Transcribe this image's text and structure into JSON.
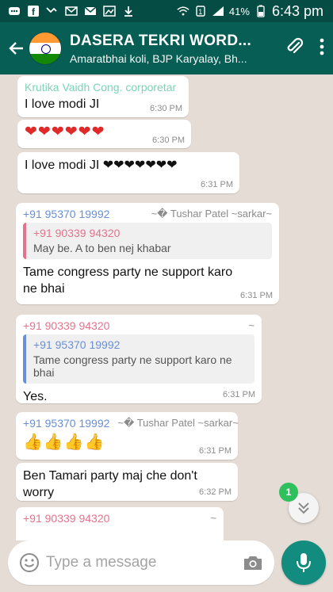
{
  "status_bar": {
    "battery_percent": "41%",
    "time": "6:43 pm"
  },
  "header": {
    "title": "DASERA TEKRI WORD...",
    "subtitle": "Amaratbhai koli, BJP Karyalay, Bh..."
  },
  "colors": {
    "header_bg": "#075e54",
    "status_bg": "#054d44",
    "chat_bg": "#e5ddd5",
    "sender_teal": "#7dd3b6",
    "sender_blue": "#6a8fd6",
    "sender_pink": "#e2738d",
    "fab_green": "#128c7e"
  },
  "messages": [
    {
      "sender": "Krutika Vaidh Cong. corporetar",
      "text": "I love modi JI",
      "time": "6:30 PM"
    },
    {
      "emoji": "❤❤❤❤❤❤",
      "time": "6:30 PM"
    },
    {
      "text": "I love modi JI ❤❤❤❤❤❤❤",
      "time": "6:31 PM"
    },
    {
      "sender": "+91 95370 19992",
      "sender_name": "~� Tushar Patel ~sarkar~",
      "quote": {
        "sender": "+91 90339 94320",
        "text": "May be. A to ben nej khabar"
      },
      "text": "Tame congress party ne support karo ne bhai",
      "time": "6:31 PM"
    },
    {
      "sender": "+91 90339 94320",
      "sender_name": "~",
      "quote": {
        "sender": "+91 95370 19992",
        "text": "Tame congress party ne support karo ne bhai"
      },
      "text": "Yes.",
      "time": "6:31 PM"
    },
    {
      "sender": "+91 95370 19992",
      "sender_name": "~� Tushar Patel ~sarkar~",
      "emoji": "👍👍👍👍",
      "time": "6:31 PM"
    },
    {
      "text": "Ben Tamari party maj che don't worry",
      "time": "6:32 PM"
    },
    {
      "sender": "+91 90339 94320",
      "sender_name": "~"
    }
  ],
  "scroll_down": {
    "unread_count": "1"
  },
  "compose": {
    "placeholder": "Type a message"
  },
  "icons": [
    "back-arrow-icon",
    "attach-icon",
    "more-vert-icon",
    "emoji-icon",
    "camera-icon",
    "mic-icon",
    "chevron-double-down-icon"
  ]
}
